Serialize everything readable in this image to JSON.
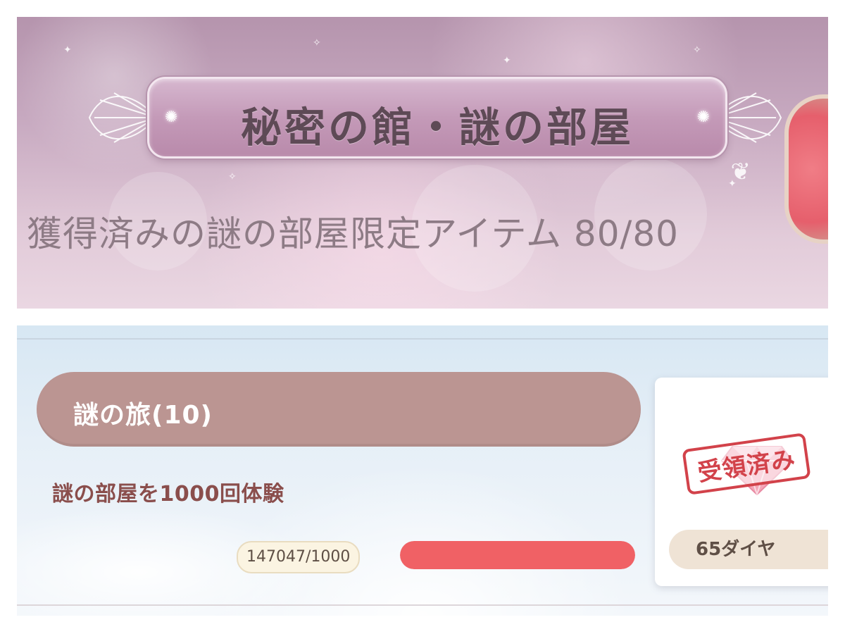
{
  "event_banner": {
    "title": "秘密の館・謎の部屋",
    "progress_caption": "獲得済みの謎の部屋限定アイテム 80/80"
  },
  "mission": {
    "title": "謎の旅(10)",
    "description": "謎の部屋を1000回体験",
    "progress_text": "147047/1000",
    "progress_fraction": 1.0,
    "reward": {
      "icon": "diamond-gem-icon",
      "label": "65ダイヤ",
      "stamp": "受領済み"
    }
  },
  "colors": {
    "banner_purple": "#c49ab8",
    "mission_header": "#bb9592",
    "progress_fill": "#f06165",
    "stamp_red": "#d2424a",
    "description_text": "#8a4e4c"
  }
}
